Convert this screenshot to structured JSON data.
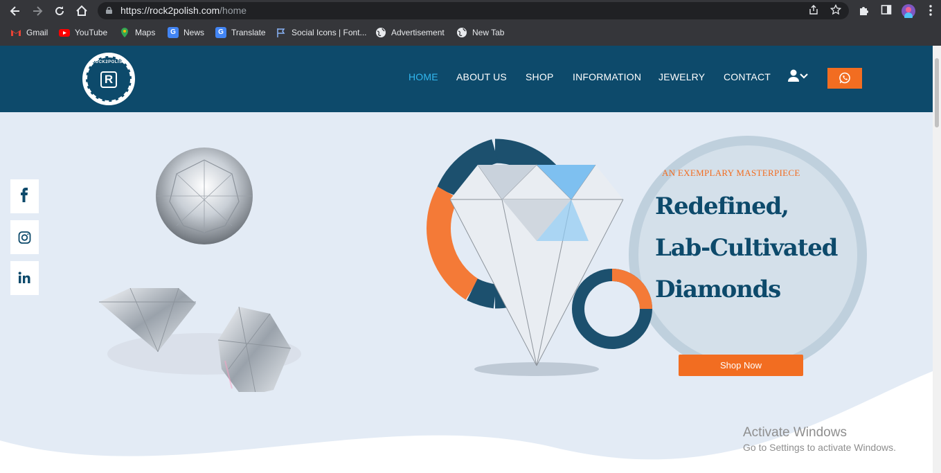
{
  "browser": {
    "url_host": "https://rock2polish.com",
    "url_path": "/home",
    "bookmarks": [
      {
        "label": "Gmail",
        "icon": "gmail-icon"
      },
      {
        "label": "YouTube",
        "icon": "youtube-icon"
      },
      {
        "label": "Maps",
        "icon": "maps-icon"
      },
      {
        "label": "News",
        "icon": "news-icon"
      },
      {
        "label": "Translate",
        "icon": "translate-icon"
      },
      {
        "label": "Social Icons | Font...",
        "icon": "flag-icon"
      },
      {
        "label": "Advertisement",
        "icon": "globe-icon"
      },
      {
        "label": "New Tab",
        "icon": "globe-icon"
      }
    ]
  },
  "site": {
    "logo_text": "ROCK2POLISH",
    "logo_tagline": "AN EXEMPLARY MASTERPIECE",
    "logo_letter": "R",
    "nav": [
      {
        "label": "HOME",
        "active": true
      },
      {
        "label": "ABOUT US"
      },
      {
        "label": "SHOP"
      },
      {
        "label": "INFORMATION"
      },
      {
        "label": "JEWELRY"
      },
      {
        "label": "CONTACT"
      }
    ],
    "social": [
      "f",
      "ig",
      "in"
    ]
  },
  "hero": {
    "eyebrow": "AN EXEMPLARY MASTERPIECE",
    "headline_1": "Redefined,",
    "headline_2": "Lab-Cultivated",
    "headline_3": "Diamonds",
    "cta": "Shop Now"
  },
  "os": {
    "watermark_1": "Activate Windows",
    "watermark_2": "Go to Settings to activate Windows."
  },
  "colors": {
    "nav_bg": "#0d4a6b",
    "accent": "#f26d21",
    "active_link": "#32b8f0",
    "hero_bg": "#e3ebf5"
  }
}
